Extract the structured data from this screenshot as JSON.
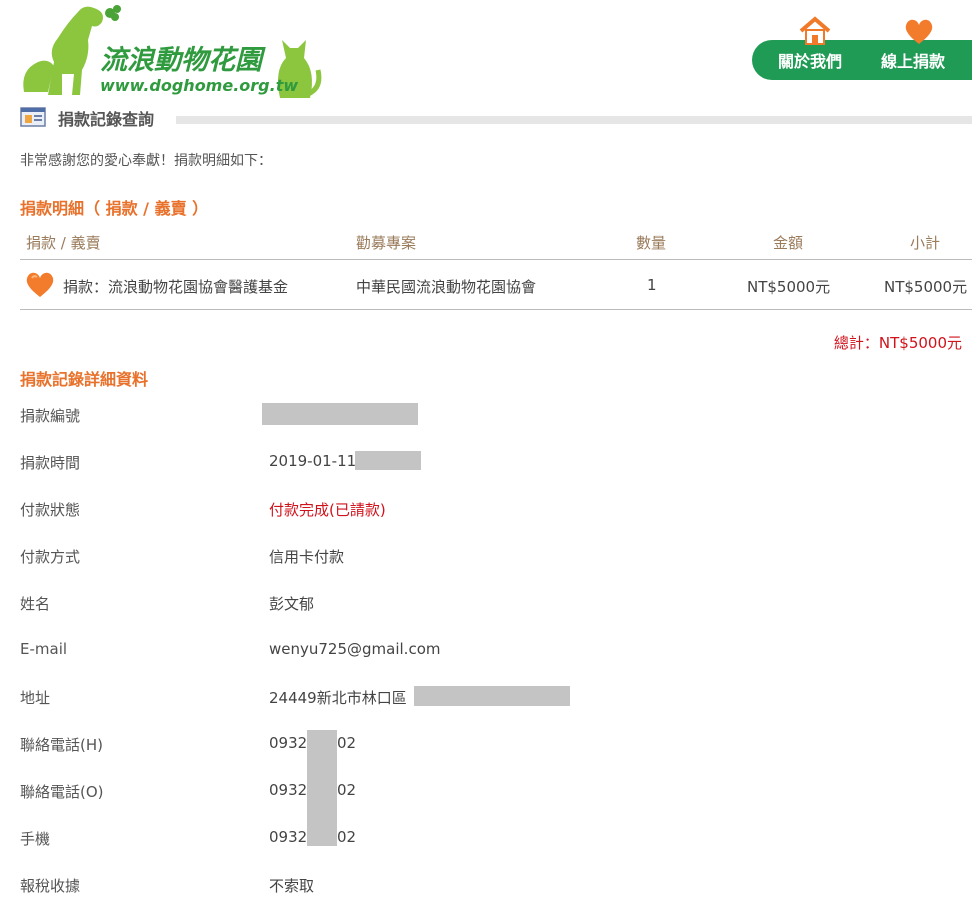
{
  "header": {
    "logo_text": "流浪動物花園",
    "logo_url_text": "www.doghome.org.tw",
    "nav": [
      {
        "label": "關於我們",
        "icon": "home-icon"
      },
      {
        "label": "線上捐款",
        "icon": "heart-icon"
      }
    ]
  },
  "section_title": "捐款記錄查詢",
  "thanks_text": "非常感謝您的愛心奉獻！捐款明細如下：",
  "donation_detail": {
    "heading": "捐款明細",
    "heading_sub": "（ 捐款 / 義賣 ）",
    "columns": [
      "捐款 / 義賣",
      "勸募專案",
      "數量",
      "金額",
      "小計"
    ],
    "rows": [
      {
        "icon": "heart-icon",
        "item": "捐款：流浪動物花園協會醫護基金",
        "project": "中華民國流浪動物花園協會",
        "qty": "1",
        "amount": "NT$5000元",
        "subtotal": "NT$5000元"
      }
    ],
    "total": "總計：NT$5000元"
  },
  "record": {
    "heading": "捐款記錄詳細資料",
    "fields": [
      {
        "label": "捐款編號",
        "value": ""
      },
      {
        "label": "捐款時間",
        "value": "2019-01-11"
      },
      {
        "label": "付款狀態",
        "value": "付款完成(已請款)"
      },
      {
        "label": "付款方式",
        "value": "信用卡付款"
      },
      {
        "label": "姓名",
        "value": "彭文郁"
      },
      {
        "label": "E-mail",
        "value": "wenyu725@gmail.com"
      },
      {
        "label": "地址",
        "value": "24449新北市林口區"
      },
      {
        "label": "聯絡電話(H)",
        "value_a": "0932",
        "value_b": "02"
      },
      {
        "label": "聯絡電話(O)",
        "value_a": "0932",
        "value_b": "02"
      },
      {
        "label": "手機",
        "value_a": "0932",
        "value_b": "02"
      },
      {
        "label": "報稅收據",
        "value": "不索取"
      }
    ]
  },
  "colors": {
    "brand_green": "#1f9b55",
    "logo_green": "#8cc63f",
    "accent_orange": "#e8722c",
    "status_red": "#d0121b"
  }
}
